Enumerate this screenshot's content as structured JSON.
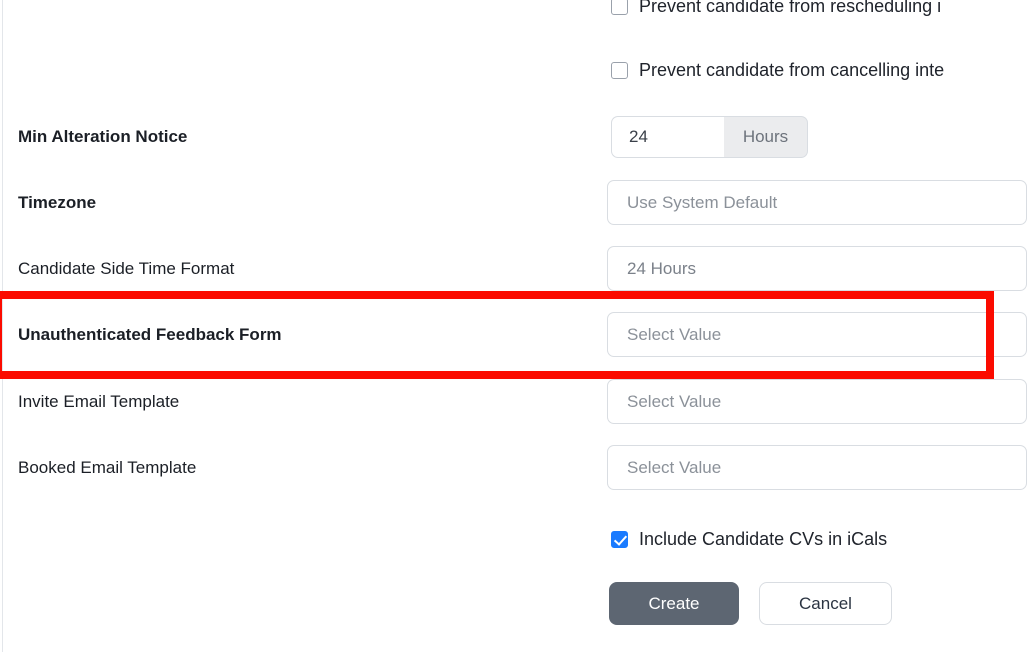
{
  "form": {
    "checkbox_rows": [
      {
        "name": "prevent-rescheduling",
        "label": "Prevent candidate from rescheduling i",
        "checked": false
      },
      {
        "name": "prevent-cancelling",
        "label": "Prevent candidate from cancelling inte",
        "checked": false
      }
    ],
    "fields": [
      {
        "name": "min-alteration-notice",
        "label": "Min Alteration Notice",
        "bold": true,
        "control": "input-group",
        "value": "24",
        "addon": "Hours"
      },
      {
        "name": "timezone",
        "label": "Timezone",
        "bold": true,
        "control": "select",
        "value": "Use System Default"
      },
      {
        "name": "candidate-side-time-format",
        "label": "Candidate Side Time Format",
        "bold": false,
        "control": "select",
        "value": "24 Hours"
      },
      {
        "name": "unauthenticated-feedback-form",
        "label": "Unauthenticated Feedback Form",
        "bold": true,
        "control": "select",
        "value": "Select Value",
        "highlighted": true
      },
      {
        "name": "invite-email-template",
        "label": "Invite Email Template",
        "bold": false,
        "control": "select",
        "value": "Select Value"
      },
      {
        "name": "booked-email-template",
        "label": "Booked Email Template",
        "bold": false,
        "control": "select",
        "value": "Select Value"
      }
    ],
    "include_cvs": {
      "label": "Include Candidate CVs in iCals",
      "checked": true
    },
    "buttons": {
      "create": "Create",
      "cancel": "Cancel"
    }
  },
  "annotation": {
    "color": "#fb0b00",
    "target": "Unauthenticated Feedback Form"
  }
}
